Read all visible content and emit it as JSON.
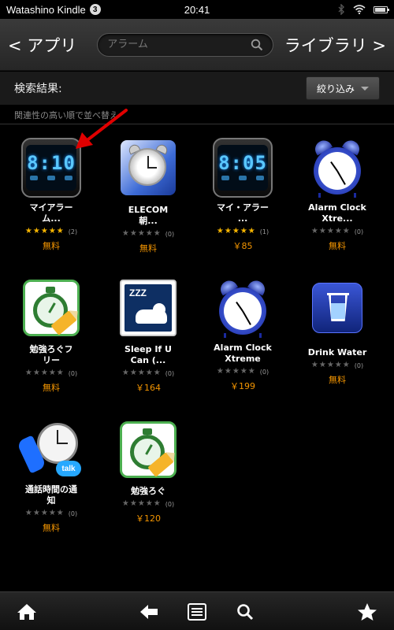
{
  "status_bar": {
    "carrier": "Watashino Kindle",
    "notification_count": "3",
    "time": "20:41"
  },
  "header": {
    "back_label": "< アプリ",
    "search_placeholder": "アラーム",
    "library_label": "ライブラリ >"
  },
  "results": {
    "label": "検索結果:",
    "filter_label": "絞り込み",
    "sort_label": "関連性の高い順で並べ替え"
  },
  "apps": [
    {
      "title_line1": "マイアラー",
      "title_line2": "ム...",
      "rating": 4.5,
      "count": "(2)",
      "price": "無料",
      "icon": "digital-clock-icon",
      "digits": "8:10"
    },
    {
      "title_line1": "ELECOM",
      "title_line2": "朝...",
      "rating": 0,
      "count": "(0)",
      "price": "無料",
      "icon": "elecom-alarm-icon"
    },
    {
      "title_line1": "マイ・アラー",
      "title_line2": "...",
      "rating": 5,
      "count": "(1)",
      "price": "￥85",
      "icon": "digital-clock-icon",
      "digits": "8:05"
    },
    {
      "title_line1": "Alarm Clock",
      "title_line2": "Xtre...",
      "rating": 0,
      "count": "(0)",
      "price": "無料",
      "icon": "alarm-clock-icon"
    },
    {
      "title_line1": "勉強ろぐフ",
      "title_line2": "リー",
      "rating": 0,
      "count": "(0)",
      "price": "無料",
      "icon": "stopwatch-pencil-icon"
    },
    {
      "title_line1": "Sleep If U",
      "title_line2": "Can (...",
      "rating": 0,
      "count": "(0)",
      "price": "￥164",
      "icon": "sleeping-baby-icon"
    },
    {
      "title_line1": "Alarm Clock",
      "title_line2": "Xtreme",
      "rating": 0,
      "count": "(0)",
      "price": "￥199",
      "icon": "alarm-clock-icon"
    },
    {
      "title_line1": "Drink Water",
      "title_line2": "",
      "rating": 0,
      "count": "(0)",
      "price": "無料",
      "icon": "water-glass-icon"
    },
    {
      "title_line1": "通話時間の通",
      "title_line2": "知",
      "rating": 0,
      "count": "(0)",
      "price": "無料",
      "icon": "call-timer-icon"
    },
    {
      "title_line1": "勉強ろぐ",
      "title_line2": "",
      "rating": 0,
      "count": "(0)",
      "price": "￥120",
      "icon": "stopwatch-pencil-icon"
    }
  ],
  "colors": {
    "price": "#f29400",
    "star_on": "#f5b400",
    "star_off": "#666666",
    "annotation_arrow": "#e00000"
  },
  "bottom_nav": [
    {
      "icon": "home-icon"
    },
    {
      "icon": "back-arrow-icon"
    },
    {
      "icon": "menu-icon"
    },
    {
      "icon": "search-icon"
    },
    {
      "icon": "favorites-star-icon"
    }
  ]
}
